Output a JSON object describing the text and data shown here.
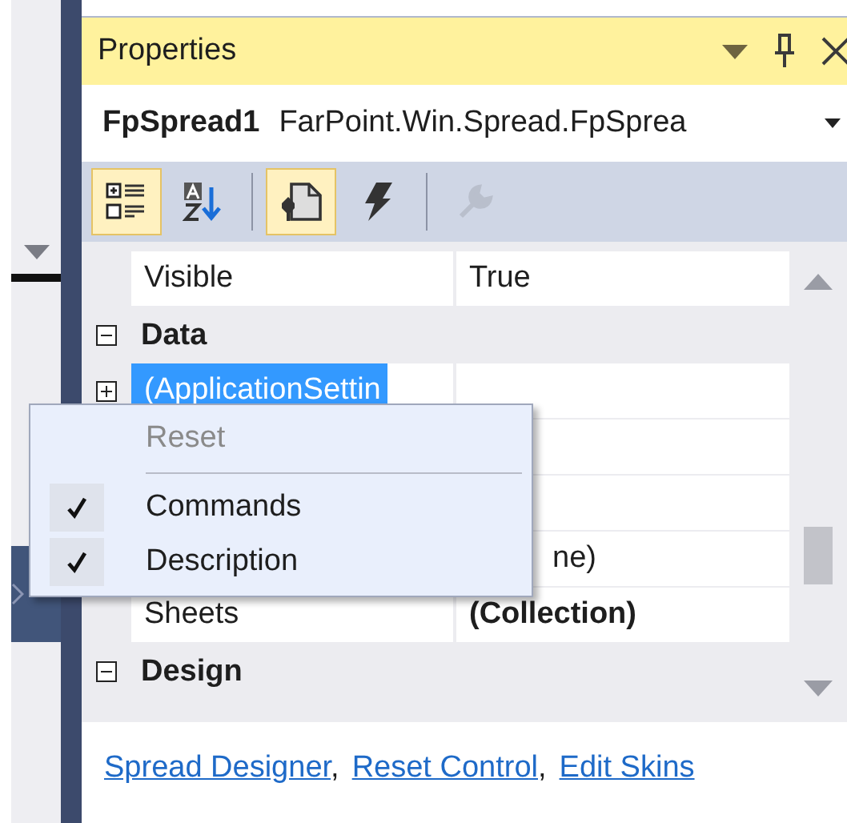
{
  "panel": {
    "title": "Properties"
  },
  "object_selector": {
    "name": "FpSpread1",
    "type": "FarPoint.Win.Spread.FpSprea"
  },
  "toolbar": [
    {
      "kind": "categorized",
      "selected": true,
      "disabled": false
    },
    {
      "kind": "alphabetical",
      "selected": false,
      "disabled": false
    },
    {
      "kind": "separator"
    },
    {
      "kind": "properties",
      "selected": true,
      "disabled": false
    },
    {
      "kind": "events",
      "selected": false,
      "disabled": false
    },
    {
      "kind": "separator"
    },
    {
      "kind": "property-pages",
      "selected": false,
      "disabled": true
    }
  ],
  "grid": {
    "rows": [
      {
        "kind": "property",
        "name": "Visible",
        "value": "True",
        "selected": false
      },
      {
        "kind": "category",
        "name": "Data",
        "expanded": true
      },
      {
        "kind": "property",
        "name": "(ApplicationSettin",
        "selected": true,
        "expanded": false
      },
      {
        "kind": "covered"
      },
      {
        "kind": "covered"
      },
      {
        "kind": "covered",
        "value": "ne)"
      },
      {
        "kind": "property",
        "name": "Sheets",
        "value": "(Collection)",
        "selected": false,
        "bold_value": true
      },
      {
        "kind": "category",
        "name": "Design",
        "expanded": true
      }
    ]
  },
  "context_menu": {
    "items": [
      {
        "kind": "item",
        "label": "Reset",
        "disabled": true,
        "checked": false
      },
      {
        "kind": "separator"
      },
      {
        "kind": "item",
        "label": "Commands",
        "disabled": false,
        "checked": true
      },
      {
        "kind": "item",
        "label": "Description",
        "disabled": false,
        "checked": true
      }
    ]
  },
  "commands": [
    {
      "label": "Spread Designer",
      "separator": ","
    },
    {
      "label": "Reset Control",
      "separator": ","
    },
    {
      "label": "Edit Skins"
    }
  ]
}
